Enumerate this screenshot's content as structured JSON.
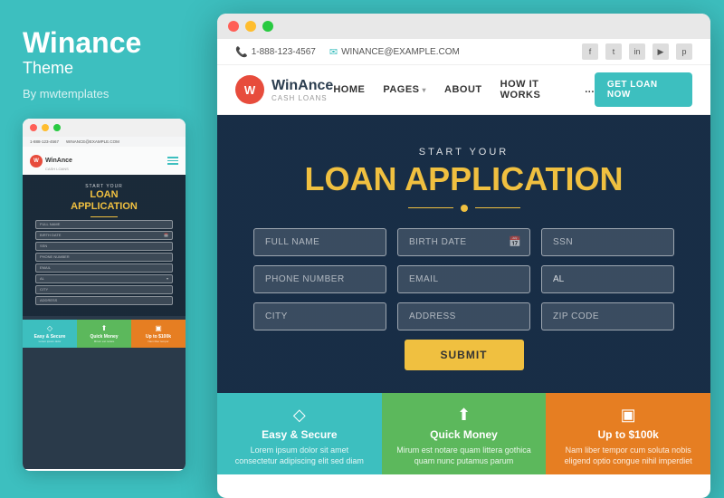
{
  "left": {
    "title": "Winance",
    "subtitle": "Theme",
    "author": "By mwtemplates"
  },
  "mini": {
    "topbar": {
      "phone": "1-888-123-4567",
      "email": "WINANCE@EXAMPLE.COM"
    },
    "logo": "W",
    "logo_main": "WinAnce",
    "logo_sub": "CASH LOANS",
    "hero_small": "START YOUR",
    "hero_title": "LOAN\nAPPLICATION",
    "fields": [
      "FULL NAME",
      "BIRTH DATE",
      "SSN",
      "PHONE NUMBER",
      "EMAIL",
      "AL",
      "CITY",
      "ADDRESS"
    ],
    "cards": [
      {
        "title": "Easy & Secure",
        "icon": "◇"
      },
      {
        "title": "Quick Money",
        "icon": "✈"
      },
      {
        "title": "Up to $100k",
        "icon": "▣"
      }
    ]
  },
  "topbar": {
    "phone": "1-888-123-4567",
    "email": "WINANCE@EXAMPLE.COM",
    "socials": [
      "f",
      "t",
      "in",
      "▶",
      "p"
    ]
  },
  "navbar": {
    "logo_letter": "W",
    "logo_main": "WinAnce",
    "logo_sub": "CASH LOANS",
    "menu": [
      {
        "label": "HOME",
        "has_arrow": false
      },
      {
        "label": "PAGES",
        "has_arrow": true
      },
      {
        "label": "ABOUT",
        "has_arrow": false
      },
      {
        "label": "HOW IT WORKS",
        "has_arrow": false
      },
      {
        "label": "...",
        "has_arrow": false
      }
    ],
    "cta": "GET LOAN NOW"
  },
  "hero": {
    "pretitle": "START YOUR",
    "title": "LOAN APPLICATION"
  },
  "form": {
    "fields": [
      {
        "placeholder": "FULL NAME",
        "type": "text",
        "icon": false
      },
      {
        "placeholder": "BIRTH DATE",
        "type": "text",
        "icon": true,
        "icon_char": "📅"
      },
      {
        "placeholder": "SSN",
        "type": "text",
        "icon": false
      },
      {
        "placeholder": "PHONE NUMBER",
        "type": "text",
        "icon": false
      },
      {
        "placeholder": "EMAIL",
        "type": "text",
        "icon": false
      },
      {
        "placeholder": "AL",
        "type": "select",
        "icon": true
      }
    ],
    "row3": [
      {
        "placeholder": "CITY",
        "type": "text",
        "icon": false
      },
      {
        "placeholder": "ADDRESS",
        "type": "text",
        "icon": false
      },
      {
        "placeholder": "ZIP CODE",
        "type": "text",
        "icon": false
      }
    ],
    "submit": "SUBMIT"
  },
  "features": [
    {
      "icon": "◇",
      "title": "Easy & Secure",
      "text": "Lorem ipsum dolor sit amet consectetur adipiscing elit sed diam",
      "color": "teal"
    },
    {
      "icon": "⬆",
      "title": "Quick Money",
      "text": "Mirum est notare quam littera gothica quam nunc putamus parum",
      "color": "green2"
    },
    {
      "icon": "▣",
      "title": "Up to $100k",
      "text": "Nam liber tempor cum soluta nobis eligend optio congue nihil imperdiet",
      "color": "orange"
    }
  ]
}
